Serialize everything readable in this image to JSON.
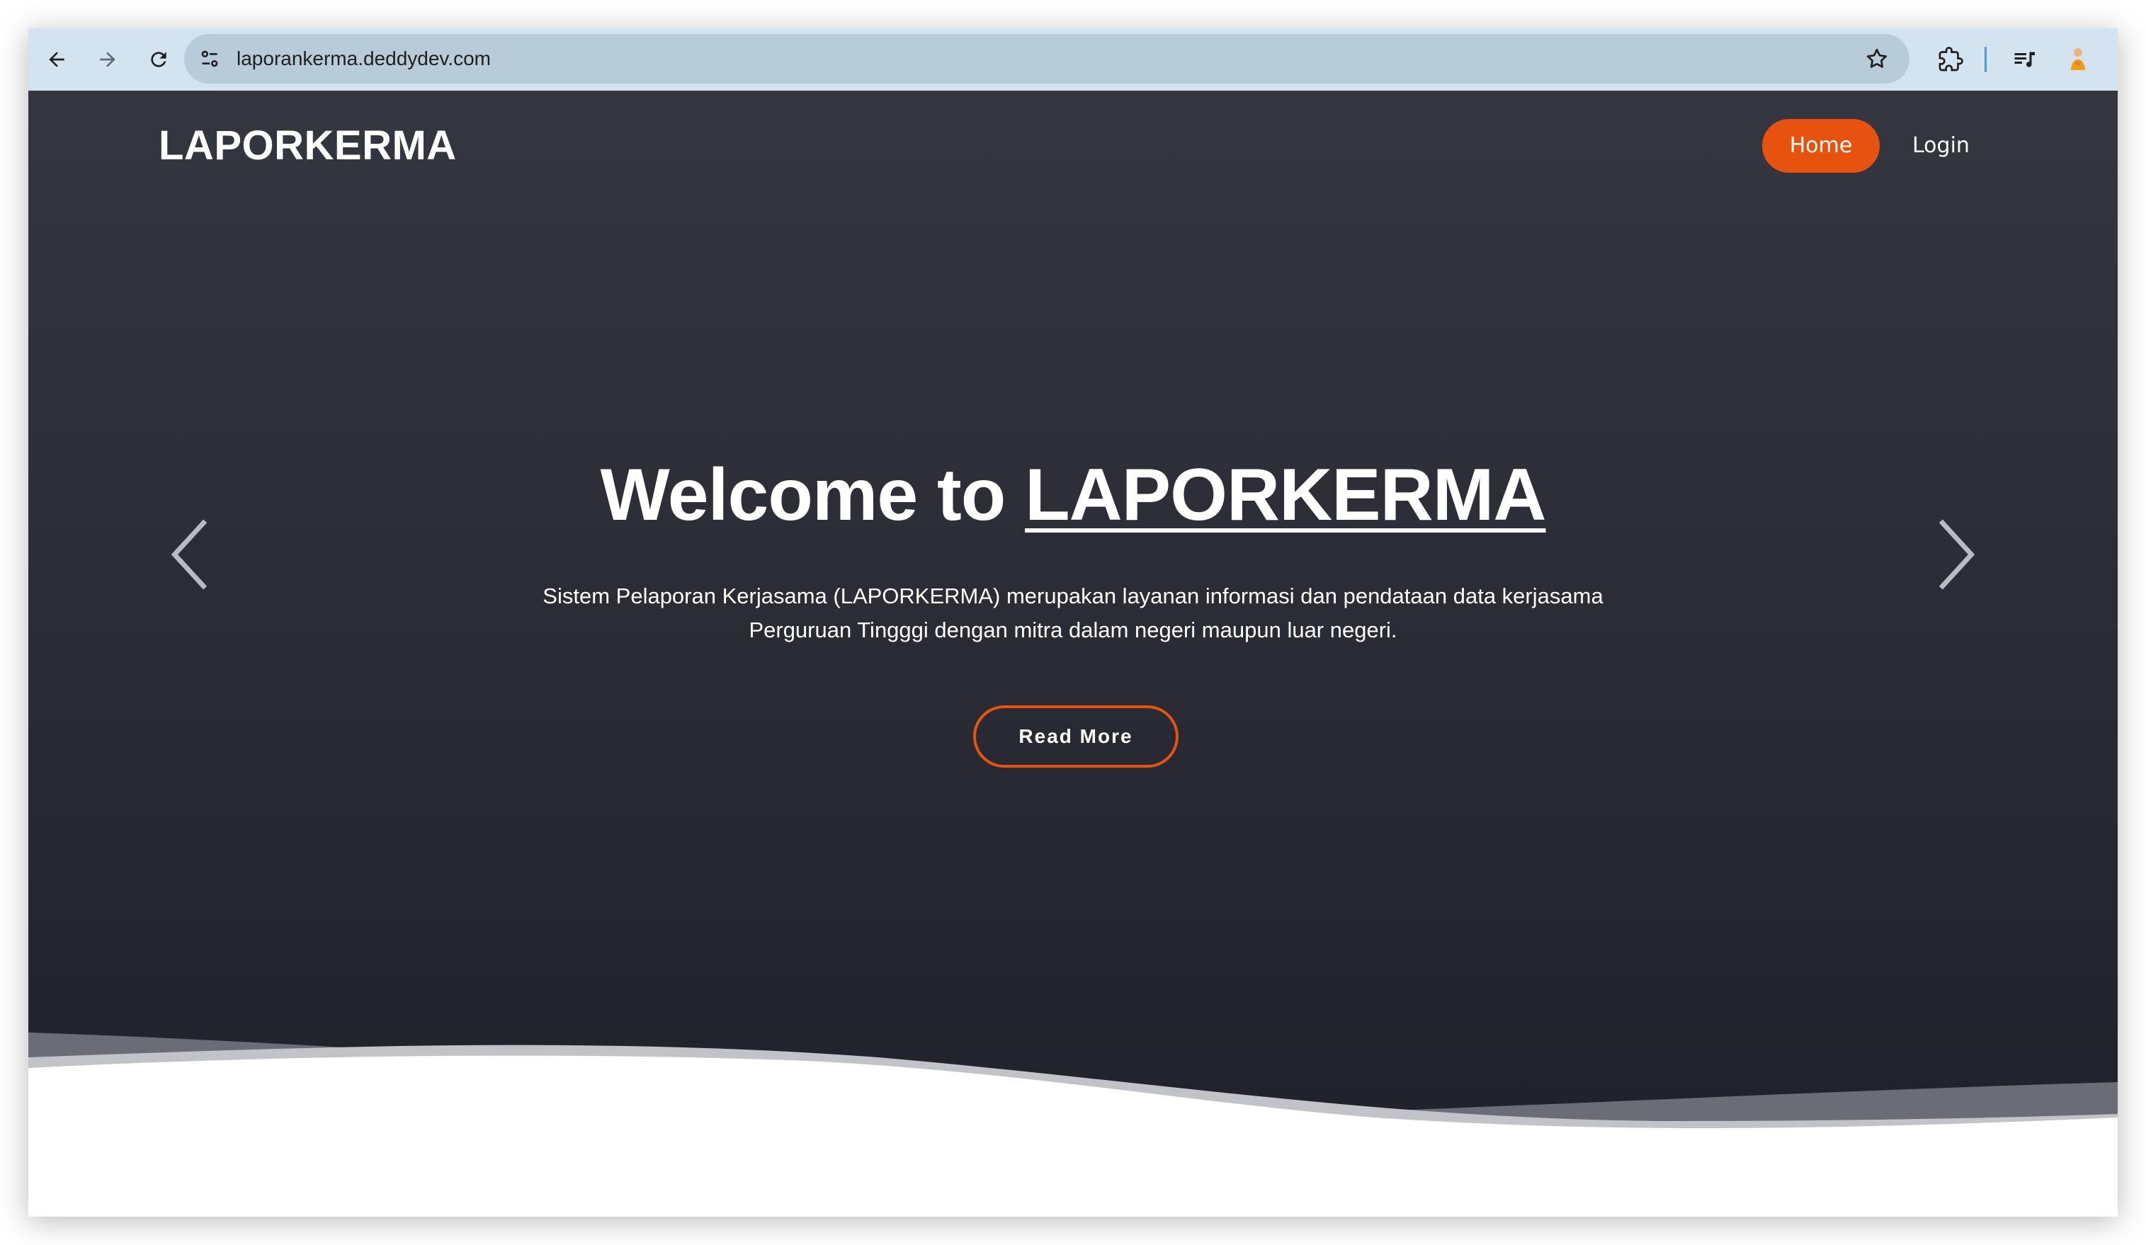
{
  "browser": {
    "url": "laporankerma.deddydev.com",
    "back_icon": "arrow-left-icon",
    "forward_icon": "arrow-right-icon",
    "reload_icon": "reload-icon",
    "site_info_icon": "tune-icon",
    "bookmark_icon": "star-icon",
    "extensions_icon": "puzzle-icon",
    "media_icon": "queue-music-icon",
    "profile_icon": "avatar-icon"
  },
  "site": {
    "brand": "LAPORKERMA",
    "nav": {
      "home": "Home",
      "login": "Login"
    },
    "hero": {
      "title_prefix": "Welcome to ",
      "title_highlight": "LAPORKERMA",
      "description": "Sistem Pelaporan Kerjasama (LAPORKERMA) merupakan layanan informasi dan pendataan data kerjasama Perguruan Tingggi dengan mitra dalam negeri maupun luar negeri.",
      "cta": "Read More",
      "prev_icon": "chevron-left-icon",
      "next_icon": "chevron-right-icon"
    }
  },
  "colors": {
    "accent": "#e8520f",
    "hero_top": "#343640",
    "hero_bottom": "#21222b",
    "chrome": "#d3e3ef",
    "omnibox": "#b8cbd8"
  }
}
